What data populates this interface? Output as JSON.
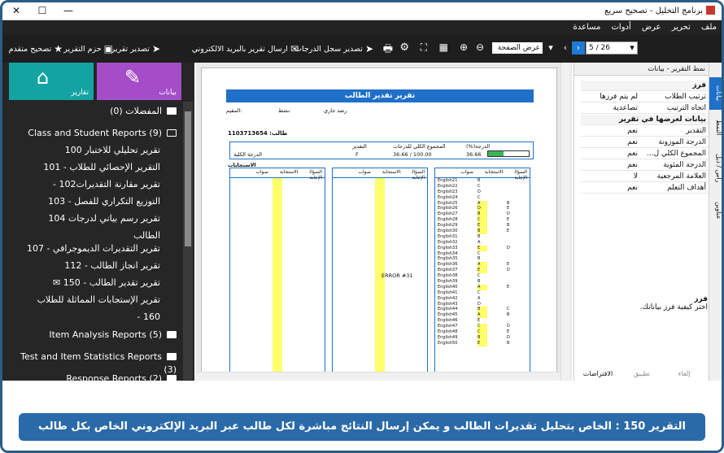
{
  "window": {
    "title": "برنامج التحليل - تصحيح سريع",
    "min": "—",
    "max": "☐",
    "close": "✕"
  },
  "menu": [
    "ملف",
    "تحرير",
    "عرض",
    "أدوات",
    "مساعدة"
  ],
  "toolbar": {
    "quick_correct": "تصحيح متقدم",
    "report_bundle": "حزم التقرير",
    "export_report": "تصدير تقرير",
    "email_report": "ارسال تقرير بالبريد الالكتروني",
    "export_grades": "تصدير سجل الدرجات",
    "zoom_mode": "عرض الصفحة",
    "page_indicator": "5 / 26"
  },
  "sidebar": {
    "tiles": [
      {
        "label": "بيانات",
        "color": "#a54dc8",
        "icon": "pencil-icon"
      },
      {
        "label": "تقارير",
        "color": "#14a3a3",
        "icon": "home-icon"
      }
    ],
    "tree": [
      {
        "label": "المفضلات (0)",
        "type": "folder"
      },
      {
        "label": "Class and Student Reports (9)",
        "type": "folder-open"
      },
      {
        "label": "تقرير تحليلي للاختبار 100",
        "type": "child"
      },
      {
        "label": "التقرير الإحصائي للطلاب - 101",
        "type": "child"
      },
      {
        "label": "تقرير مقارنة التقديرات102 -",
        "type": "child"
      },
      {
        "label": "التوزيع التكراري للفصل - 103",
        "type": "child"
      },
      {
        "label": "تقرير رسم بياني لدرجات 104",
        "type": "child"
      },
      {
        "label": "الطالب",
        "type": "child-cont"
      },
      {
        "label": "تقرير التقديرات الديموجرافي - 107",
        "type": "child"
      },
      {
        "label": "تقرير انجاز الطالب - 112",
        "type": "child"
      },
      {
        "label": "تقرير تقدير الطالب - 150",
        "type": "child-selected"
      },
      {
        "label": "تقرير الإستجابات المماثلة للطلاب",
        "type": "child"
      },
      {
        "label": "160 -",
        "type": "child-cont"
      },
      {
        "label": "Item Analysis Reports (5)",
        "type": "folder"
      },
      {
        "label": "Test and Item Statistics Reports (3)",
        "type": "folder"
      },
      {
        "label": "Response Reports (2)",
        "type": "folder"
      }
    ]
  },
  "document": {
    "header": "تقرير تقدير الطالب",
    "filters": [
      "المقيم:",
      "نشط:",
      "رصد جاري"
    ],
    "student": "طالب: 1103713654",
    "summary_headers": [
      "(%)الدرجة",
      "المجموع الكلي للدرجات",
      "التقدير"
    ],
    "summary_values": [
      "36.66",
      "36.66 / 100.00",
      "F"
    ],
    "summary_label": "الدرجة الكلية",
    "responses_label": "الاستجابات",
    "col_headers": [
      "السؤال",
      "الاستجابة",
      "صواب الإجابة"
    ],
    "col3_rows": [
      [
        "English21",
        "B",
        ""
      ],
      [
        "English22",
        "C",
        ""
      ],
      [
        "English23",
        "D",
        ""
      ],
      [
        "English24",
        "C",
        ""
      ],
      [
        "English25",
        "A",
        "B"
      ],
      [
        "English26",
        "D",
        "E"
      ],
      [
        "English27",
        "B",
        "D"
      ],
      [
        "English28",
        "C",
        "E"
      ],
      [
        "English29",
        "E",
        "B"
      ],
      [
        "English30",
        "B",
        "E"
      ],
      [
        "English31",
        "B",
        ""
      ],
      [
        "English32",
        "A",
        ""
      ],
      [
        "English33",
        "E",
        "D"
      ],
      [
        "English34",
        "C",
        ""
      ],
      [
        "English35",
        "B",
        ""
      ],
      [
        "English36",
        "A",
        "E"
      ],
      [
        "English37",
        "E",
        "D"
      ],
      [
        "English38",
        "C",
        ""
      ],
      [
        "English39",
        "B",
        ""
      ],
      [
        "English40",
        "A",
        "E"
      ],
      [
        "English41",
        "C",
        ""
      ],
      [
        "English42",
        "A",
        ""
      ],
      [
        "English43",
        "D",
        ""
      ],
      [
        "English44",
        "B",
        "C"
      ],
      [
        "English45",
        "A",
        "B"
      ],
      [
        "English46",
        "E",
        ""
      ],
      [
        "English47",
        "C",
        "D"
      ],
      [
        "English48",
        "C",
        "E"
      ],
      [
        "English49",
        "B",
        "D"
      ],
      [
        "English50",
        "E",
        "B"
      ]
    ],
    "error_text": "ERROR #31"
  },
  "properties": {
    "title": "نمط التقرير - بيانات",
    "rows": [
      {
        "k": "فرز",
        "v": "",
        "cat": true
      },
      {
        "k": "ترتيب الطلاب",
        "v": "لم يتم فرزها"
      },
      {
        "k": "اتجاه الترتيب",
        "v": "تصاعدية"
      },
      {
        "k": "بيانات لعرضها في تقرير",
        "v": "",
        "cat": true
      },
      {
        "k": "التقدير",
        "v": "نعم"
      },
      {
        "k": "الدرجة الموزونة",
        "v": "نعم"
      },
      {
        "k": "المجموع الكلي ل...",
        "v": "نعم"
      },
      {
        "k": "الدرجة المئوية",
        "v": "نعم"
      },
      {
        "k": "العلامة المرجعية",
        "v": "لا"
      },
      {
        "k": "أهداف التعلم",
        "v": "نعم"
      }
    ],
    "desc_title": "فرز",
    "desc_text": "اختر كيفية فرز بياناتك.",
    "buttons": [
      "إلغاء",
      "تطبيق",
      "الافتراضات"
    ]
  },
  "vertical_tabs": [
    "بيانات",
    "النمط",
    "رأس / ذيل",
    "عناوين"
  ],
  "caption": "التقرير 150 : الخاص بتحليل تقديرات الطالب و يمكن إرسال النتائج مباشرة لكل طالب عبر البريد الإلكتروني الخاص بكل طالب"
}
